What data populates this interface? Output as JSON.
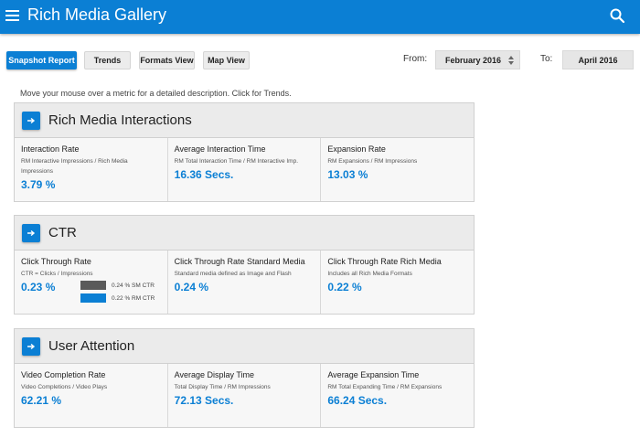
{
  "app": {
    "title": "Rich Media Gallery"
  },
  "toolbar": {
    "snapshot": "Snapshot Report",
    "trends": "Trends",
    "formats": "Formats View",
    "map": "Map View",
    "from_label": "From:",
    "from_value": "February 2016",
    "to_label": "To:",
    "to_value": "April 2016"
  },
  "hint": "Move your mouse over a metric for a detailed description. Click for Trends.",
  "colors": {
    "accent": "#0b7fd4",
    "sm_bar": "#5a5a5a",
    "rm_bar": "#0b7fd4"
  },
  "icons": {
    "menu": "hamburger-menu-icon",
    "search": "search-icon",
    "expand": "arrow-right-icon"
  },
  "panels": [
    {
      "title": "Rich Media Interactions",
      "metrics": [
        {
          "name": "Interaction Rate",
          "desc": "RM Interactive Impressions / Rich Media Impressions",
          "value": "3.79 %"
        },
        {
          "name": "Average Interaction Time",
          "desc": "RM Total Interaction Time / RM Interactive Imp.",
          "value": "16.36 Secs."
        },
        {
          "name": "Expansion Rate",
          "desc": "RM Expansions / RM Impressions",
          "value": "13.03 %"
        }
      ]
    },
    {
      "title": "CTR",
      "metrics": [
        {
          "name": "Click Through Rate",
          "desc": "CTR = Clicks / Impressions",
          "value": "0.23 %",
          "legend": [
            {
              "label": "0.24 % SM CTR"
            },
            {
              "label": "0.22 % RM CTR"
            }
          ]
        },
        {
          "name": "Click Through Rate Standard Media",
          "desc": "Standard media defined as Image and Flash",
          "value": "0.24 %"
        },
        {
          "name": "Click Through Rate Rich Media",
          "desc": "Includes all Rich Media Formats",
          "value": "0.22 %"
        }
      ]
    },
    {
      "title": "User Attention",
      "metrics": [
        {
          "name": "Video Completion Rate",
          "desc": "Video Completions / Video Plays",
          "value": "62.21 %"
        },
        {
          "name": "Average Display Time",
          "desc": "Total Display Time / RM Impressions",
          "value": "72.13 Secs."
        },
        {
          "name": "Average Expansion Time",
          "desc": "RM Total Expanding Time / RM Expansions",
          "value": "66.24 Secs."
        }
      ]
    }
  ]
}
